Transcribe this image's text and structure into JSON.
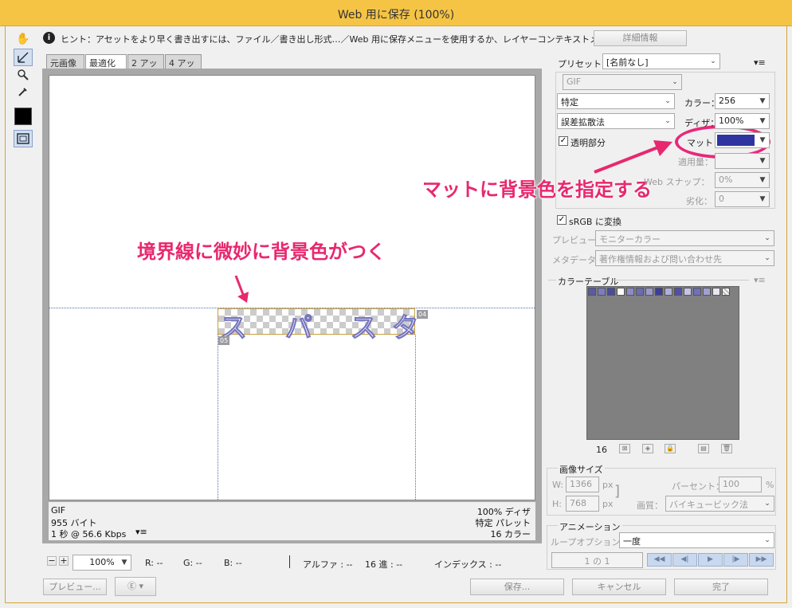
{
  "window": {
    "title": "Web 用に保存 (100%)"
  },
  "tools": [
    {
      "name": "hand-tool",
      "icon": "hand-icon",
      "glyph": "✋"
    },
    {
      "name": "slice-select-tool",
      "icon": "slice-select-icon",
      "glyph": "⊿"
    },
    {
      "name": "zoom-tool",
      "icon": "zoom-icon",
      "glyph": "🔍"
    },
    {
      "name": "eyedropper-tool",
      "icon": "eyedropper-icon",
      "glyph": "✎"
    }
  ],
  "hint": {
    "text": "ヒント：アセットをより早く書き出すには、ファイル／書き出し形式…／Web 用に保存メニューを使用するか、レイヤーコンテキストメニューを使用。",
    "detail_button": "詳細情報"
  },
  "tabs": [
    {
      "label": "元画像"
    },
    {
      "label": "最適化",
      "active": true
    },
    {
      "label": "2 アップ"
    },
    {
      "label": "4 アップ"
    }
  ],
  "canvas": {
    "slice_text": "ス パ スタ",
    "slice_badges": [
      "04",
      "05"
    ]
  },
  "info": {
    "format": "GIF",
    "size": "955 バイト",
    "time": "1 秒 @ 56.6 Kbps",
    "dither": "100% ディザ",
    "palette": "特定 パレット",
    "colors": "16 カラー"
  },
  "annotations": {
    "left": "境界線に微妙に背景色がつく",
    "right": "マットに背景色を指定する"
  },
  "statusbar": {
    "zoom": "100%",
    "r": "R: --",
    "g": "G: --",
    "b": "B: --",
    "alpha": "アルファ : --",
    "hex": "16 進 : --",
    "index": "インデックス : --"
  },
  "footer": {
    "preview_button": "プレビュー...",
    "save_button": "保存...",
    "cancel_button": "キャンセル",
    "done_button": "完了"
  },
  "settings": {
    "preset_label": "プリセット：",
    "preset_value": "[名前なし]",
    "format": "GIF",
    "palette": "特定",
    "colors_label": "カラー：",
    "colors_value": "256",
    "dither_algo": "誤差拡散法",
    "dither_label": "ディザ：",
    "dither_value": "100%",
    "transparency_label": "透明部分",
    "matte_label": "マット：",
    "matte_color": "#2e35a0",
    "amount_label": "適用量：",
    "websnap_label": "Web スナップ：",
    "websnap_value": "0%",
    "lossy_label": "劣化：",
    "lossy_value": "0",
    "srgb_label": "sRGB に変換",
    "preview_label": "プレビュー：",
    "preview_value": "モニターカラー",
    "metadata_label": "メタデータ：",
    "metadata_value": "著作権情報および問い合わせ先"
  },
  "color_table": {
    "title": "カラーテーブル",
    "count": "16",
    "swatches": [
      "#5a5aa6",
      "#7d7dc0",
      "#4b4b9e",
      "#fcfcfc",
      "#8c8cc8",
      "#6b6bb4",
      "#9a9ad0",
      "#3d3d96",
      "#b0b0dc",
      "#5050a8",
      "#c4c4e6",
      "#7070b8",
      "#a0a0d4",
      "#e6e6f4"
    ]
  },
  "image_size": {
    "title": "画像サイズ",
    "w_label": "W:",
    "w_value": "1366",
    "h_label": "H:",
    "h_value": "768",
    "unit": "px",
    "percent_label": "パーセント：",
    "percent_value": "100",
    "percent_unit": "%",
    "quality_label": "画質：",
    "quality_value": "バイキュービック法"
  },
  "animation": {
    "title": "アニメーション",
    "loop_label": "ループオプション：",
    "loop_value": "一度",
    "frame": "1 の 1"
  },
  "colors": {
    "titlebar": "#f6c445",
    "accent": "#e8286e"
  }
}
